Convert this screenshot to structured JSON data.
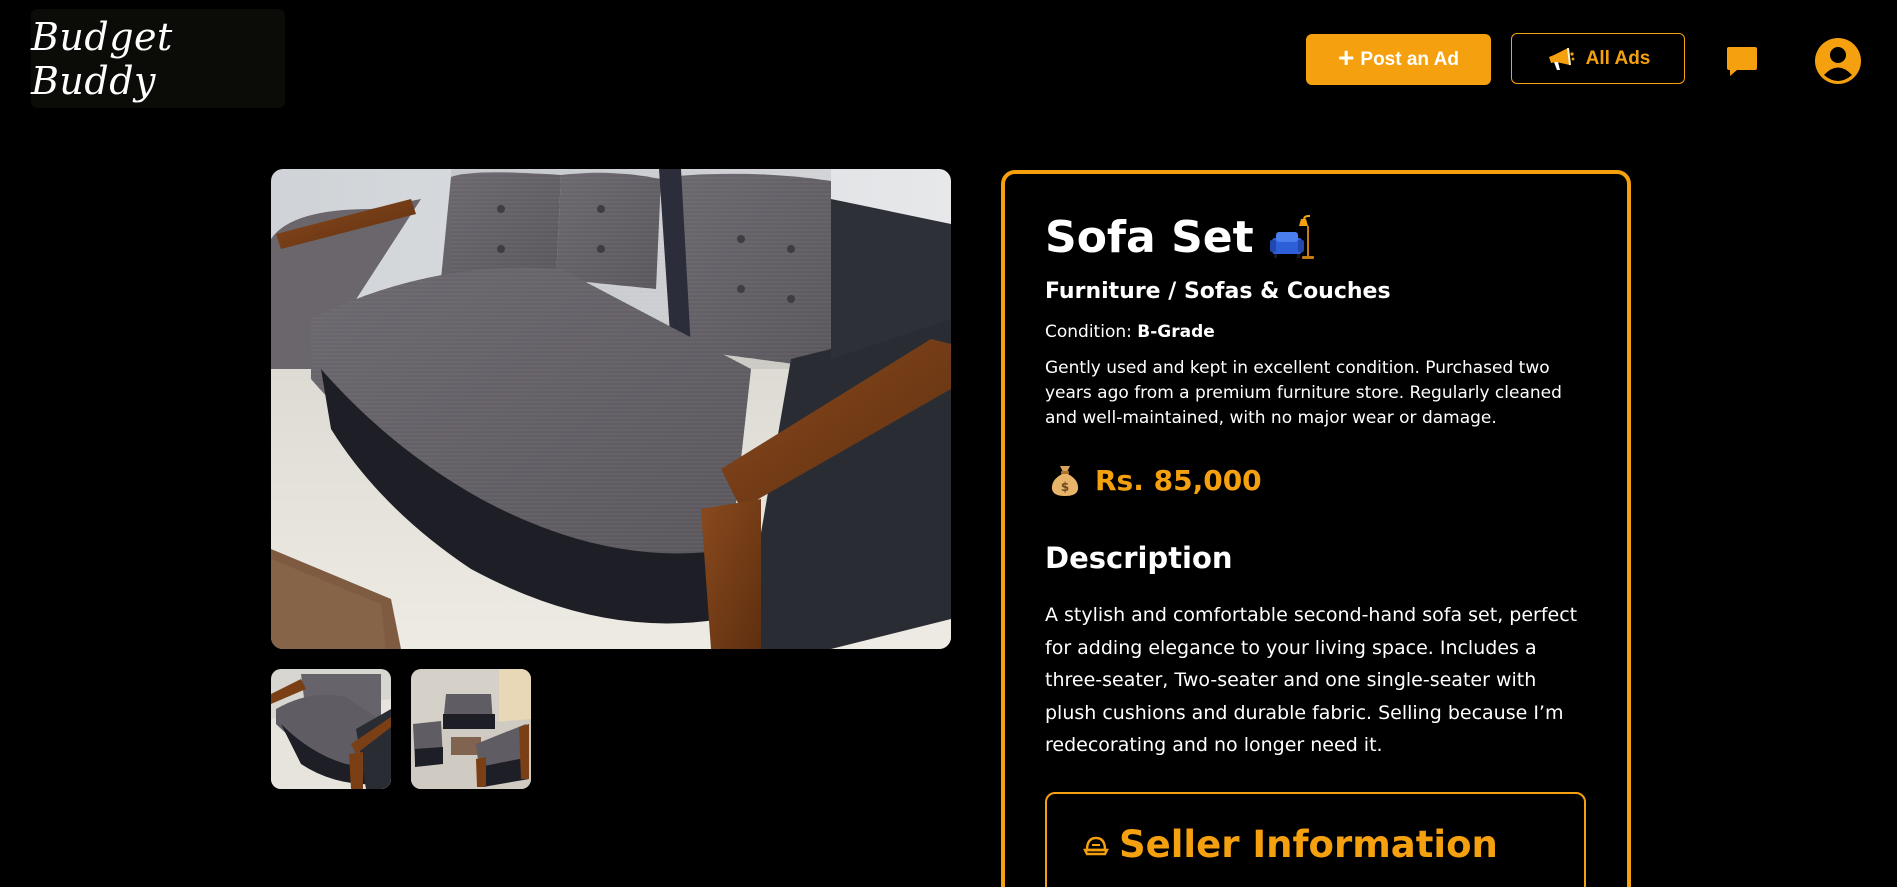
{
  "header": {
    "logo_text": "Budget Buddy",
    "post_ad_label": "Post an Ad",
    "all_ads_label": "All Ads",
    "icons": [
      "plus-icon",
      "megaphone-icon",
      "chat-icon",
      "user-avatar-icon"
    ]
  },
  "listing": {
    "title": "Sofa Set",
    "title_icon": "sofa-lamp-icon",
    "category": "Furniture / Sofas & Couches",
    "condition_label": "Condition:",
    "condition_value": "B-Grade",
    "short_description": "Gently used and kept in excellent condition. Purchased two years ago from a premium furniture store. Regularly cleaned and well-maintained, with no major wear or damage.",
    "price_icon": "money-bag-icon",
    "price": "Rs. 85,000",
    "description_heading": "Description",
    "description": "A stylish and comfortable second-hand sofa set, perfect for adding elegance to your living space. Includes a three-seater, Two-seater and one single-seater with plush cushions and durable fabric. Selling because I’m redecorating and no longer need it.",
    "seller_heading": "Seller Information",
    "seller_icon": "seller-icon"
  },
  "gallery": {
    "main_image": "sofa-photo-main",
    "thumbnails": [
      "sofa-thumbnail-1",
      "sofa-thumbnail-2"
    ]
  },
  "colors": {
    "accent": "#f5a00f",
    "background": "#000000",
    "text": "#ffffff"
  }
}
